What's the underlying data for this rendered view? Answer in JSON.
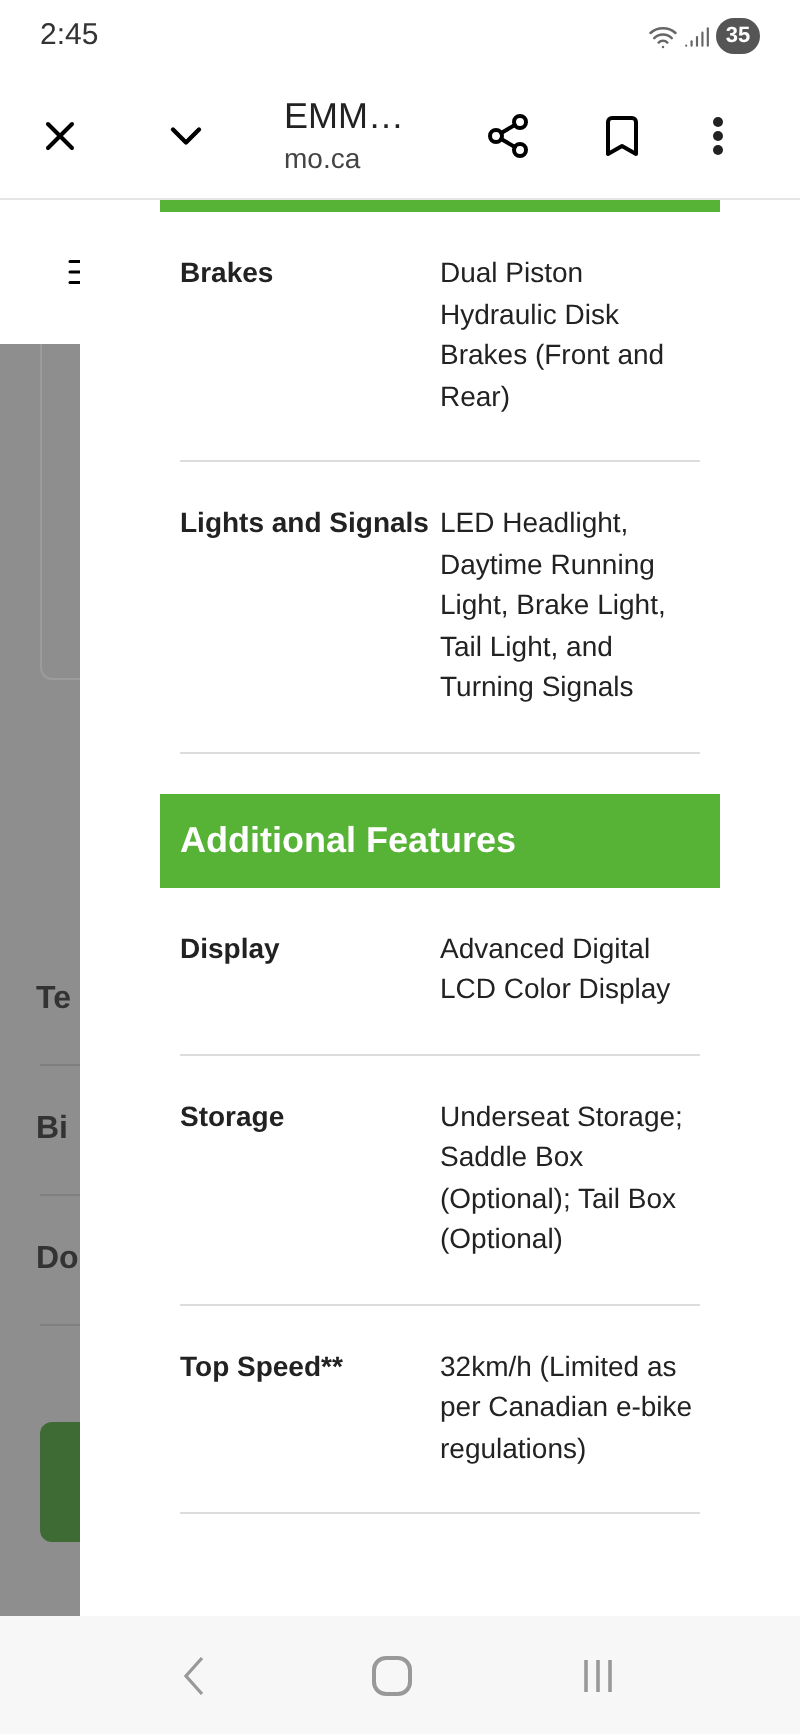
{
  "status_bar": {
    "time": "2:45",
    "battery": "35"
  },
  "browser_bar": {
    "title": "EMM…",
    "url": "mo.ca"
  },
  "background_page": {
    "texts": [
      "Te",
      "Bi",
      "Do"
    ]
  },
  "specs_top": [
    {
      "label": "Brakes",
      "value": "Dual Piston Hydraulic Disk Brakes (Front and Rear)"
    },
    {
      "label": "Lights and Signals",
      "value": "LED Headlight, Daytime Running Light, Brake Light, Tail Light, and Turning Signals"
    }
  ],
  "section": {
    "title": "Additional Features"
  },
  "specs": [
    {
      "label": "Display",
      "value": "Advanced Digital LCD Color Display"
    },
    {
      "label": "Storage",
      "value": "Underseat Storage; Saddle Box (Optional); Tail Box (Optional)"
    },
    {
      "label": "Top Speed**",
      "value": "32km/h (Limited as per Canadian e-bike regulations)"
    }
  ]
}
